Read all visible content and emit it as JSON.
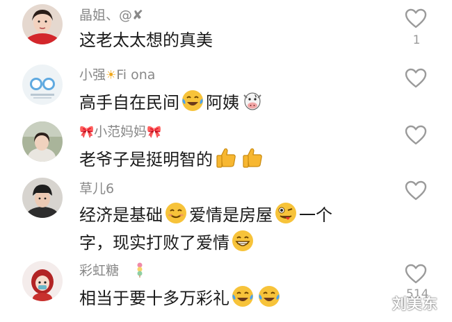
{
  "comments": [
    {
      "name": "晶姐、@✘",
      "text": "这老太太想的真美",
      "likes": "1"
    },
    {
      "name": "小强",
      "name_suffix": "Fi ona",
      "text_a": "高手自在民间",
      "text_b": "阿姨",
      "likes": ""
    },
    {
      "name": "小范妈妈",
      "text": "老爷子是挺明智的",
      "likes": ""
    },
    {
      "name": "草儿6",
      "text_line1_a": "经济是基础",
      "text_line1_b": "爱情是房屋",
      "text_line1_c": "一个",
      "text_line2": "字，现实打败了爱情",
      "likes": ""
    },
    {
      "name": "彩虹糖",
      "text": "相当于要十多万彩礼",
      "likes": "514"
    }
  ],
  "watermark": "刘美东",
  "icons": [
    "heart-outline-icon",
    "laugh-cry-emoji",
    "cow-emoji",
    "thumbs-up-emoji",
    "smile-emoji",
    "wink-tongue-emoji",
    "grin-emoji",
    "bow-icon",
    "sun-icon",
    "candy-icon"
  ],
  "colors": {
    "name_gray": "#888888",
    "heart_gray": "#9a9a9a",
    "bow_red": "#e8322c",
    "emoji_yellow": "#f7c33a"
  }
}
